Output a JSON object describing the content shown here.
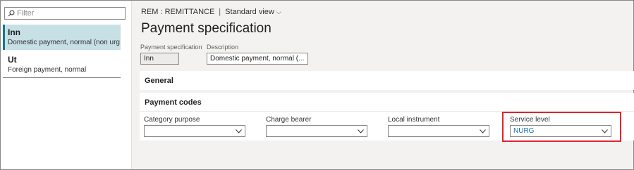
{
  "filter": {
    "placeholder": "Filter"
  },
  "list": [
    {
      "title": "Inn",
      "subtitle": "Domestic payment, normal (non urg..."
    },
    {
      "title": "Ut",
      "subtitle": "Foreign payment, normal"
    }
  ],
  "breadcrumb": {
    "entity": "REM : REMITTANCE",
    "view": "Standard view"
  },
  "page_title": "Payment specification",
  "header_fields": {
    "spec_label": "Payment specification",
    "spec_value": "Inn",
    "desc_label": "Description",
    "desc_value": "Domestic payment, normal (..."
  },
  "sections": {
    "general": "General",
    "payment_codes": "Payment codes"
  },
  "payment_codes": {
    "category_purpose_label": "Category purpose",
    "category_purpose_value": "",
    "charge_bearer_label": "Charge bearer",
    "charge_bearer_value": "",
    "local_instrument_label": "Local instrument",
    "local_instrument_value": "",
    "service_level_label": "Service level",
    "service_level_value": "NURG"
  },
  "colors": {
    "selected_bg": "#c7e0e6",
    "accent": "#117a8b",
    "highlight": "#e5212f",
    "link_value": "#0f6cbd"
  },
  "icons": [
    "search-icon",
    "chevron-down-icon"
  ]
}
